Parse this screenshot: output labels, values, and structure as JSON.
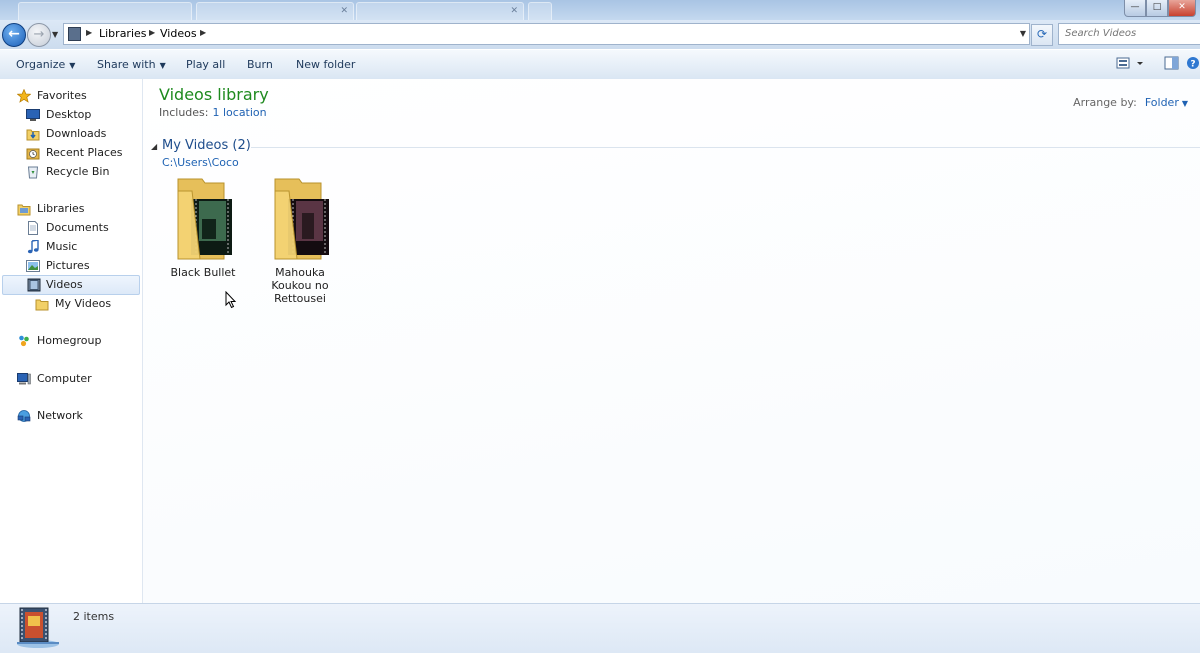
{
  "window": {
    "minimize": "—",
    "maximize": "□",
    "close": "✕"
  },
  "nav": {
    "back": "←",
    "forward": "→"
  },
  "address": {
    "crumbs": [
      "Libraries",
      "Videos"
    ]
  },
  "search": {
    "placeholder": "Search Videos"
  },
  "toolbar": {
    "organize": "Organize",
    "share_with": "Share with",
    "play_all": "Play all",
    "burn": "Burn",
    "new_folder": "New folder"
  },
  "sidebar": {
    "favorites": {
      "label": "Favorites",
      "items": [
        "Desktop",
        "Downloads",
        "Recent Places",
        "Recycle Bin"
      ]
    },
    "libraries": {
      "label": "Libraries",
      "items": [
        "Documents",
        "Music",
        "Pictures",
        "Videos"
      ],
      "sub_items": [
        "My Videos"
      ],
      "selected": "Videos"
    },
    "homegroup": "Homegroup",
    "computer": "Computer",
    "network": "Network"
  },
  "content": {
    "title": "Videos library",
    "includes_label": "Includes:",
    "includes_link": "1 location",
    "arrange_label": "Arrange by:",
    "arrange_value": "Folder",
    "group": {
      "title": "My Videos (2)",
      "path": "C:\\Users\\Coco",
      "folders": [
        {
          "name": "Black Bullet"
        },
        {
          "name": "Mahouka Koukou no Rettousei"
        }
      ]
    }
  },
  "status": {
    "items_count": "2 items"
  },
  "icons": {
    "favorites": "star-icon",
    "desktop": "desktop-icon",
    "downloads": "downloads-folder-icon",
    "recent": "recent-places-icon",
    "recycle": "recycle-bin-icon",
    "libraries": "libraries-icon",
    "documents": "documents-icon",
    "music": "music-note-icon",
    "pictures": "pictures-icon",
    "videos": "videos-icon",
    "homegroup": "homegroup-icon",
    "computer": "computer-icon",
    "network": "network-icon"
  },
  "colors": {
    "library_title": "#1e8a1e",
    "link": "#1f62b3",
    "group_title": "#1e4d8c",
    "selected_bg": "#dde9f8"
  }
}
